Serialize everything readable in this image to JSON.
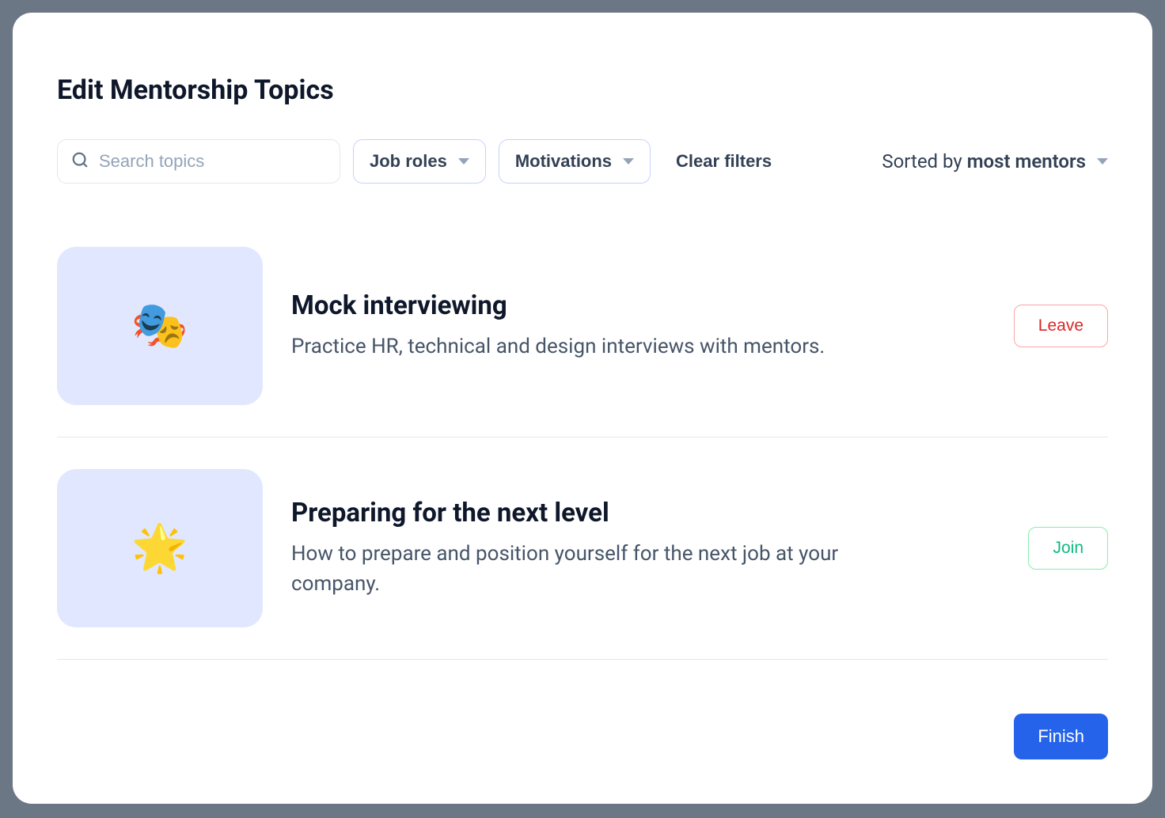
{
  "header": {
    "title": "Edit Mentorship Topics"
  },
  "search": {
    "placeholder": "Search topics"
  },
  "filters": [
    {
      "label": "Job roles"
    },
    {
      "label": "Motivations"
    }
  ],
  "clear_filters_label": "Clear filters",
  "sort": {
    "prefix": "Sorted by ",
    "value": "most mentors"
  },
  "topics": [
    {
      "icon": "🎭",
      "title": "Mock interviewing",
      "description": "Practice HR, technical and design interviews with mentors.",
      "action_label": "Leave",
      "action_type": "leave"
    },
    {
      "icon": "🌟",
      "title": "Preparing for the next level",
      "description": "How to prepare and position yourself for the next job at your company.",
      "action_label": "Join",
      "action_type": "join"
    }
  ],
  "finish_label": "Finish"
}
